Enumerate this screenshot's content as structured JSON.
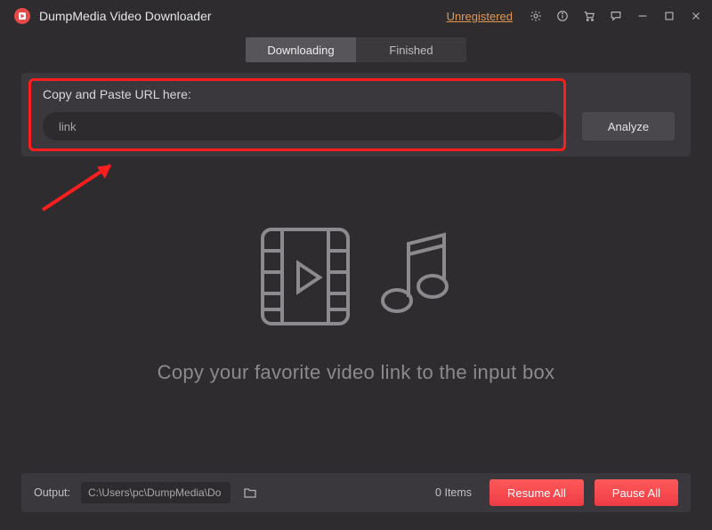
{
  "titlebar": {
    "app_title": "DumpMedia Video Downloader",
    "unregistered": "Unregistered"
  },
  "tabs": {
    "downloading": "Downloading",
    "finished": "Finished"
  },
  "url_panel": {
    "label": "Copy and Paste URL here:",
    "input_value": "link",
    "analyze": "Analyze"
  },
  "center": {
    "hint": "Copy your favorite video link to the input box"
  },
  "bottom": {
    "output_label": "Output:",
    "output_path": "C:\\Users\\pc\\DumpMedia\\Do",
    "items": "0 Items",
    "resume_all": "Resume All",
    "pause_all": "Pause All"
  }
}
